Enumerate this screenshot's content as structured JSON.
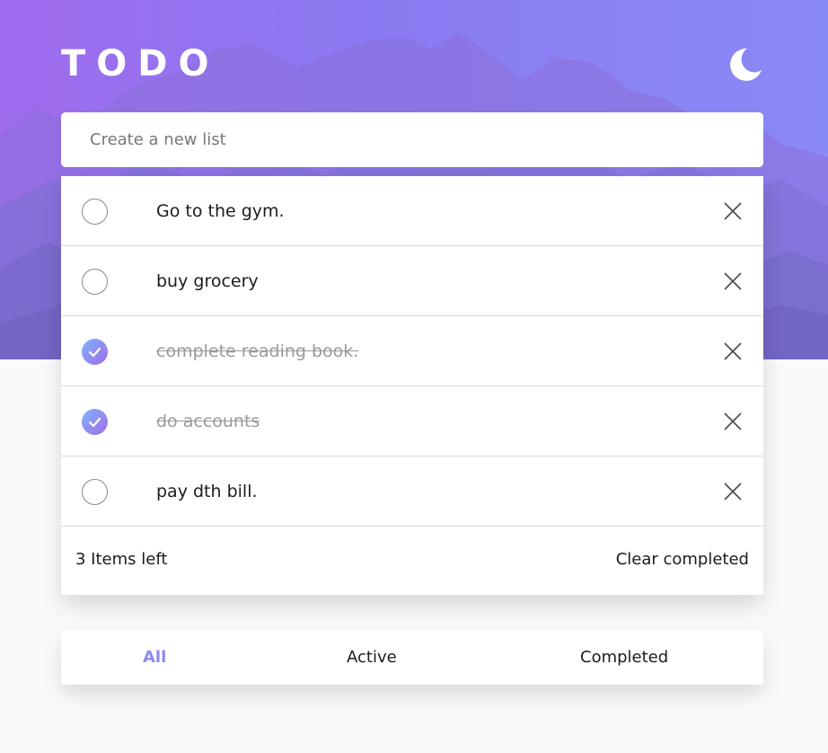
{
  "app": {
    "title": "TODO",
    "theme_toggle_icon": "moon-icon"
  },
  "colors": {
    "accent": "#8b8bf0",
    "check_gradient_start": "#7fb2ff",
    "check_gradient_end": "#a06ee6",
    "hero_start": "#9f6bee",
    "hero_end": "#8a8af6"
  },
  "new_item": {
    "placeholder": "Create a new list",
    "value": ""
  },
  "todos": [
    {
      "text": "Go to the gym.",
      "completed": false
    },
    {
      "text": "buy grocery",
      "completed": false
    },
    {
      "text": "complete reading book.",
      "completed": true
    },
    {
      "text": "do accounts",
      "completed": true
    },
    {
      "text": "pay dth bill.",
      "completed": false
    }
  ],
  "footer": {
    "items_left": "3 Items left",
    "clear_label": "Clear completed"
  },
  "filters": {
    "all": "All",
    "active": "Active",
    "completed": "Completed",
    "selected": "All"
  }
}
